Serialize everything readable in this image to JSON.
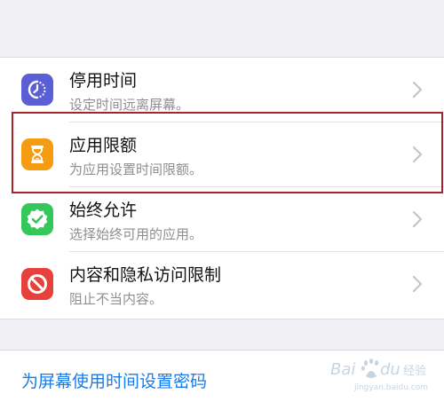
{
  "colors": {
    "background": "#efeff4",
    "downtime_icon": "#5b5fd6",
    "app_limits_icon": "#f59c13",
    "always_allowed_icon": "#34c759",
    "content_privacy_icon": "#e8403a",
    "link": "#1a7ae8",
    "highlight_border": "#a8242a"
  },
  "settings": [
    {
      "title": "停用时间",
      "subtitle": "设定时间远离屏幕。",
      "icon": "downtime-icon"
    },
    {
      "title": "应用限额",
      "subtitle": "为应用设置时间限额。",
      "icon": "hourglass-icon"
    },
    {
      "title": "始终允许",
      "subtitle": "选择始终可用的应用。",
      "icon": "checkmark-badge-icon"
    },
    {
      "title": "内容和隐私访问限制",
      "subtitle": "阻止不当内容。",
      "icon": "no-entry-icon"
    }
  ],
  "passcode_link": "为屏幕使用时间设置密码",
  "watermark": {
    "brand": "Baidu",
    "text": "经验",
    "url": "jingyan.baidu.com"
  }
}
